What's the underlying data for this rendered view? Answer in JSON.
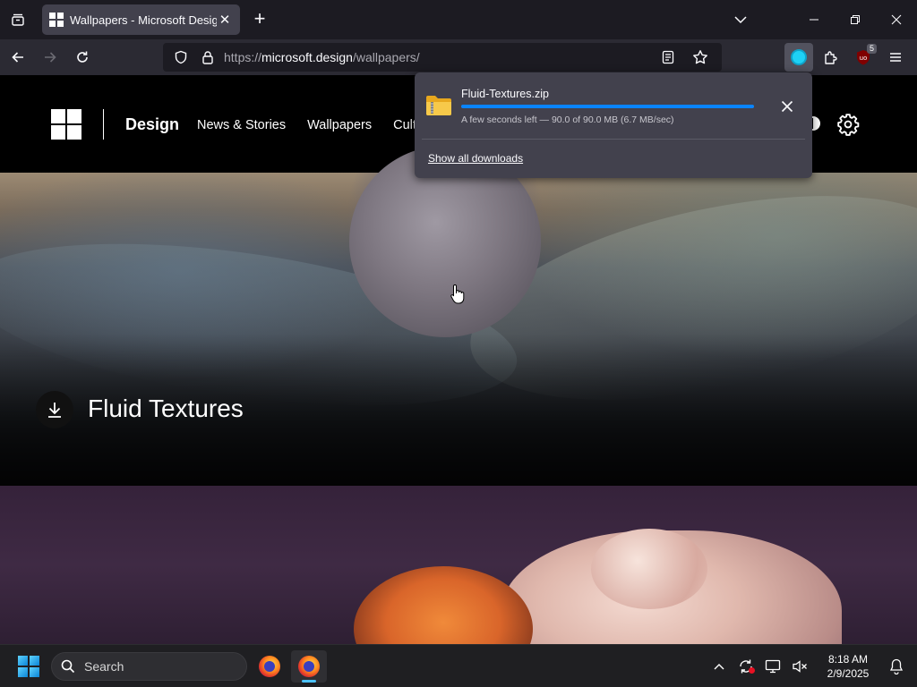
{
  "browser": {
    "tab": {
      "title": "Wallpapers - Microsoft Design"
    },
    "url": {
      "scheme": "https://",
      "host": "microsoft.design",
      "path": "/wallpapers/"
    },
    "toolbar": {
      "extensions_badge": "5"
    }
  },
  "site": {
    "brand": "Design",
    "nav": [
      "News & Stories",
      "Wallpapers",
      "Cultu"
    ]
  },
  "hero": {
    "first_title": "Fluid Textures"
  },
  "downloads": {
    "file_name": "Fluid-Textures.zip",
    "progress": 1.0,
    "status": "A few seconds left — 90.0 of 90.0 MB (6.7 MB/sec)",
    "show_all": "Show all downloads",
    "progress_color": "#0a84ff"
  },
  "taskbar": {
    "search_placeholder": "Search",
    "time": "8:18 AM",
    "date": "2/9/2025"
  },
  "icons": {
    "tab_list": "tab-list-icon",
    "back": "back-arrow-icon",
    "forward": "forward-arrow-icon",
    "reload": "reload-icon",
    "shield": "tracking-shield-icon",
    "lock": "lock-icon",
    "reader": "reader-view-icon",
    "bookmark": "star-icon",
    "download": "download-icon",
    "extensions": "puzzle-icon",
    "ublock": "ublock-icon",
    "menu": "hamburger-menu-icon"
  }
}
